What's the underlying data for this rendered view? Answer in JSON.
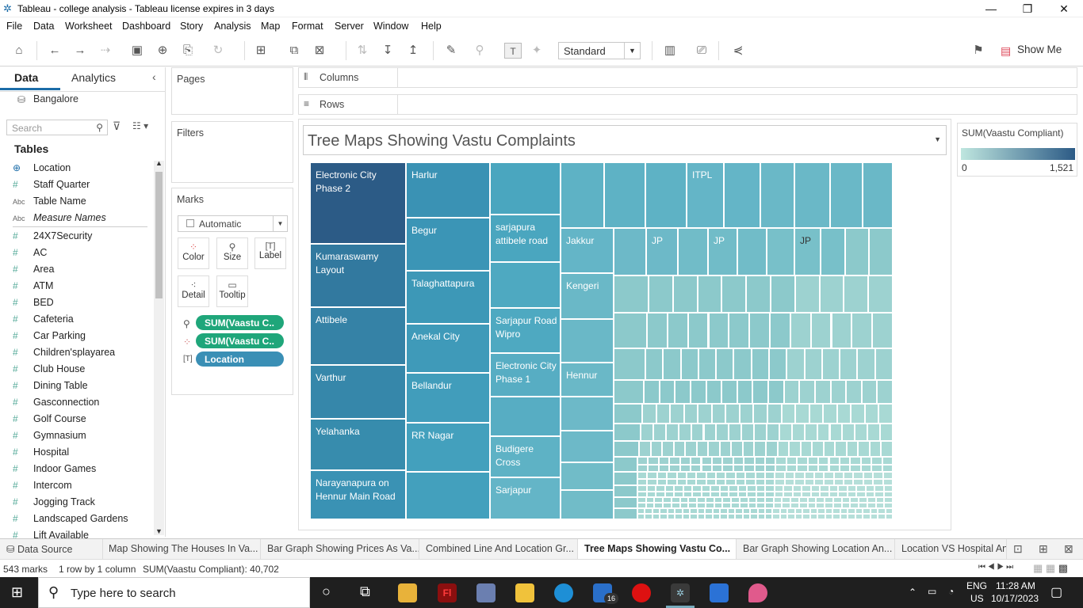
{
  "window": {
    "title": "Tableau - college analysis - Tableau license expires in 3 days"
  },
  "menu": [
    "File",
    "Data",
    "Worksheet",
    "Dashboard",
    "Story",
    "Analysis",
    "Map",
    "Format",
    "Server",
    "Window",
    "Help"
  ],
  "toolbar": {
    "fit_mode": "Standard",
    "show_me": "Show Me"
  },
  "left_pane": {
    "tabs": [
      "Data",
      "Analytics"
    ],
    "datasource": "Bangalore",
    "search_placeholder": "Search",
    "tables_header": "Tables",
    "fields": [
      {
        "name": "Location",
        "type": "geo"
      },
      {
        "name": "Staff Quarter",
        "type": "measure"
      },
      {
        "name": "Table Name",
        "type": "abc"
      },
      {
        "name": "Measure Names",
        "type": "abc"
      },
      {
        "name": "24X7Security",
        "type": "measure"
      },
      {
        "name": "AC",
        "type": "measure"
      },
      {
        "name": "Area",
        "type": "measure"
      },
      {
        "name": "ATM",
        "type": "measure"
      },
      {
        "name": "BED",
        "type": "measure"
      },
      {
        "name": "Cafeteria",
        "type": "measure"
      },
      {
        "name": "Car Parking",
        "type": "measure"
      },
      {
        "name": "Children'splayarea",
        "type": "measure"
      },
      {
        "name": "Club House",
        "type": "measure"
      },
      {
        "name": "Dining Table",
        "type": "measure"
      },
      {
        "name": "Gasconnection",
        "type": "measure"
      },
      {
        "name": "Golf Course",
        "type": "measure"
      },
      {
        "name": "Gymnasium",
        "type": "measure"
      },
      {
        "name": "Hospital",
        "type": "measure"
      },
      {
        "name": "Indoor Games",
        "type": "measure"
      },
      {
        "name": "Intercom",
        "type": "measure"
      },
      {
        "name": "Jogging Track",
        "type": "measure"
      },
      {
        "name": "Landscaped Gardens",
        "type": "measure"
      },
      {
        "name": "Lift Available",
        "type": "measure"
      }
    ]
  },
  "cards": {
    "pages": "Pages",
    "filters": "Filters",
    "marks": "Marks",
    "mark_type": "Automatic",
    "mark_buttons": [
      "Color",
      "Size",
      "Label",
      "Detail",
      "Tooltip"
    ],
    "pills": [
      "SUM(Vaastu C..",
      "SUM(Vaastu C..",
      "Location"
    ]
  },
  "shelves": {
    "columns": "Columns",
    "rows": "Rows"
  },
  "viz": {
    "title": "Tree Maps Showing Vastu Complaints"
  },
  "legend": {
    "title": "SUM(Vaastu Compliant)",
    "min": "0",
    "max": "1,521"
  },
  "treemap_labels": [
    "Electronic City Phase 2",
    "Kumaraswamy Layout",
    "Attibele",
    "Varthur",
    "Yelahanka",
    "Narayanapura on Hennur Main Road",
    "Harlur",
    "Begur",
    "Talaghattapura",
    "Anekal City",
    "Bellandur",
    "RR Nagar",
    "sarjapura attibele road",
    "Sarjapur Road Wipro",
    "Electronic City Phase 1",
    "Budigere Cross",
    "Sarjapur",
    "Jakkur",
    "Kengeri",
    "Hennur",
    "ITPL",
    "JP",
    "JP",
    "JP"
  ],
  "sheet_tabs": [
    "Data Source",
    "Map  Showing The Houses In Va...",
    "Bar Graph Showing Prices As Va...",
    "Combined Line And Location Gr...",
    "Tree Maps Showing Vastu Co...",
    "Bar Graph Showing Location An...",
    "Location VS Hospital An"
  ],
  "status": {
    "marks": "543 marks",
    "dims": "1 row by 1 column",
    "sum": "SUM(Vaastu Compliant): 40,702"
  },
  "taskbar": {
    "search": "Type here to search",
    "lang1": "ENG",
    "lang2": "US",
    "time": "11:28 AM",
    "date": "10/17/2023",
    "mail_badge": "16"
  },
  "colors": {
    "dark": "#2c5b86",
    "teal_mid": "#4a9fba",
    "light": "#a8dad6"
  }
}
